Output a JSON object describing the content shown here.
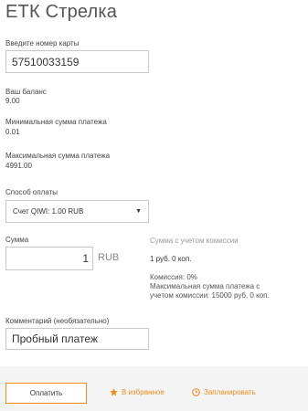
{
  "page": {
    "title": "ЕТК Стрелка"
  },
  "card": {
    "label": "Введите номер карты",
    "value": "57510033159"
  },
  "balance": {
    "label": "Ваш баланс",
    "value": "9.00"
  },
  "min_payment": {
    "label": "Минимальная сумма платежа",
    "value": "0.01"
  },
  "max_payment": {
    "label": "Максимальная сумма платежа",
    "value": "4991.00"
  },
  "payment_method": {
    "label": "Способ оплаты",
    "selected": "Счет QIWI: 1.00 RUB"
  },
  "amount": {
    "label": "Сумма",
    "value": "1",
    "currency": "RUB"
  },
  "commission": {
    "header": "Сумма с учетом комиссии",
    "total": "1 руб. 0 коп.",
    "line1": "Комиссия: 0%",
    "line2": "Максимальная сумма платежа с",
    "line3": "учетом комиссии: 15000 руб. 0 коп."
  },
  "comment": {
    "label": "Комментарий (необязательно)",
    "value": "Пробный платеж"
  },
  "actions": {
    "pay": "Оплатить",
    "favorite": "В избранное",
    "schedule": "Запланировать"
  },
  "colors": {
    "accent": "#f28c1d",
    "footer_bg": "#f4f4f4",
    "border": "#c8c8c8"
  },
  "icons": {
    "favorite": "star-icon",
    "schedule": "clock-icon",
    "dropdown": "caret-down-icon"
  }
}
